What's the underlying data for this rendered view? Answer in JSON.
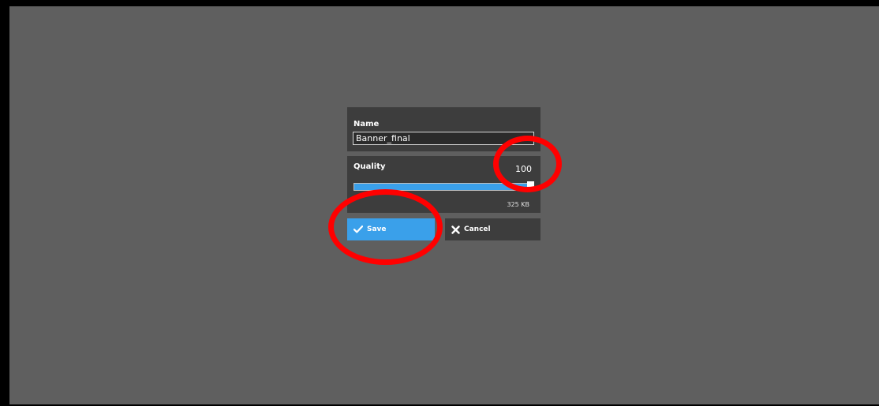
{
  "dialog": {
    "name_label": "Name",
    "name_value": "Banner_final",
    "quality_label": "Quality",
    "quality_value": "100",
    "quality_level_percent": 100,
    "file_size": "325 KB",
    "save_label": "Save",
    "cancel_label": "Cancel"
  },
  "icons": {
    "save": "check-icon",
    "cancel": "close-icon"
  },
  "colors": {
    "background": "#5f5f5f",
    "panel": "#3d3d3d",
    "accent": "#3aa0ea",
    "annotation": "#ff0000"
  }
}
